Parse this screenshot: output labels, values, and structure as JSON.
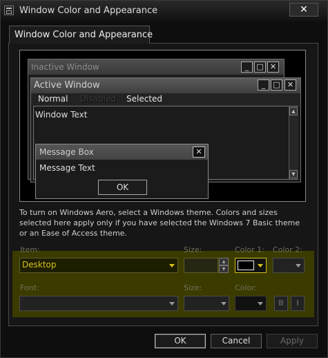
{
  "window": {
    "title": "Window Color and Appearance",
    "close_glyph": "✕"
  },
  "tab": {
    "label": "Window Color and Appearance"
  },
  "preview": {
    "inactive_title": "Inactive Window",
    "active_title": "Active Window",
    "caption_glyphs": {
      "minimize": "_",
      "maximize": "□",
      "close": "✕"
    },
    "menu": {
      "normal": "Normal",
      "disabled": "Disabled",
      "selected": "Selected"
    },
    "window_text": "Window Text",
    "message_box": {
      "title": "Message Box",
      "text": "Message Text",
      "ok_label": "OK"
    }
  },
  "info_text": "To turn on Windows Aero, select a Windows theme.  Colors and sizes selected here apply only if you have selected the Windows 7 Basic theme or an Ease of Access theme.",
  "settings": {
    "item_label": "Item:",
    "item_value": "Desktop",
    "size_label": "Size:",
    "color1_label": "Color 1:",
    "color2_label": "Color 2:",
    "font_label": "Font:",
    "font_size_label": "Size:",
    "font_color_label": "Color:",
    "bold_label": "B",
    "italic_label": "I"
  },
  "buttons": {
    "ok": "OK",
    "cancel": "Cancel",
    "apply": "Apply"
  },
  "colors": {
    "highlight": "#3b3b00",
    "item_text": "#d6c21b",
    "background": "#0e0e0e"
  }
}
